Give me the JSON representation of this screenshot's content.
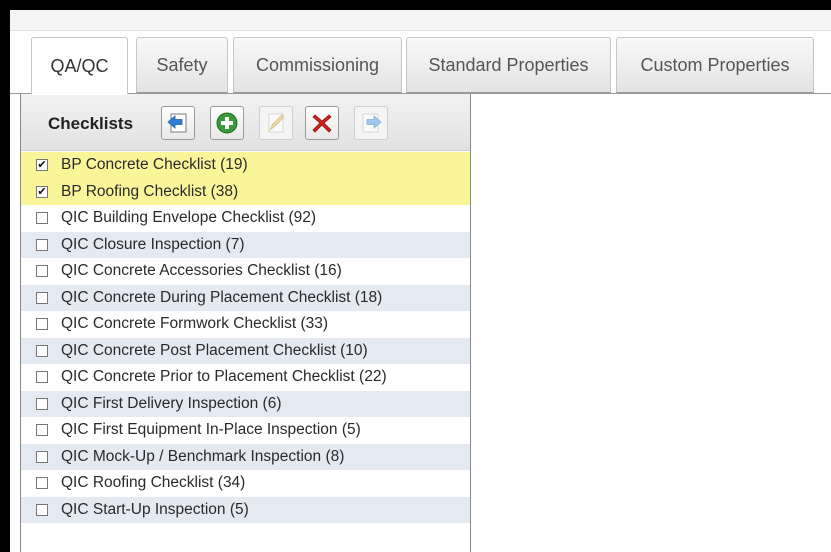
{
  "tabs": [
    {
      "label": "QA/QC",
      "active": true
    },
    {
      "label": "Safety",
      "active": false
    },
    {
      "label": "Commissioning",
      "active": false
    },
    {
      "label": "Standard Properties",
      "active": false
    },
    {
      "label": "Custom Properties",
      "active": false
    }
  ],
  "toolbar": {
    "title": "Checklists",
    "buttons": [
      {
        "icon": "import-arrow-icon",
        "enabled": true
      },
      {
        "icon": "add-icon",
        "enabled": true
      },
      {
        "icon": "edit-pencil-icon",
        "enabled": false
      },
      {
        "icon": "delete-x-icon",
        "enabled": true
      },
      {
        "icon": "export-arrow-icon",
        "enabled": false
      }
    ]
  },
  "checklists": [
    {
      "label": "BP Concrete Checklist (19)",
      "checked": true
    },
    {
      "label": "BP Roofing Checklist (38)",
      "checked": true
    },
    {
      "label": "QIC Building Envelope Checklist (92)",
      "checked": false
    },
    {
      "label": "QIC Closure Inspection (7)",
      "checked": false
    },
    {
      "label": "QIC Concrete Accessories Checklist (16)",
      "checked": false
    },
    {
      "label": "QIC Concrete During Placement Checklist (18)",
      "checked": false
    },
    {
      "label": "QIC Concrete Formwork Checklist (33)",
      "checked": false
    },
    {
      "label": "QIC Concrete Post Placement Checklist (10)",
      "checked": false
    },
    {
      "label": "QIC Concrete Prior to Placement Checklist (22)",
      "checked": false
    },
    {
      "label": "QIC First Delivery Inspection (6)",
      "checked": false
    },
    {
      "label": "QIC First Equipment In-Place Inspection (5)",
      "checked": false
    },
    {
      "label": "QIC Mock-Up / Benchmark Inspection (8)",
      "checked": false
    },
    {
      "label": "QIC Roofing Checklist (34)",
      "checked": false
    },
    {
      "label": "QIC Start-Up Inspection (5)",
      "checked": false
    }
  ],
  "colors": {
    "selected_row": "#fbf59a",
    "alt_row": "#e4e9f2",
    "add_green": "#3a9a3a",
    "delete_red": "#d42020",
    "arrow_blue": "#2f7fd0"
  }
}
